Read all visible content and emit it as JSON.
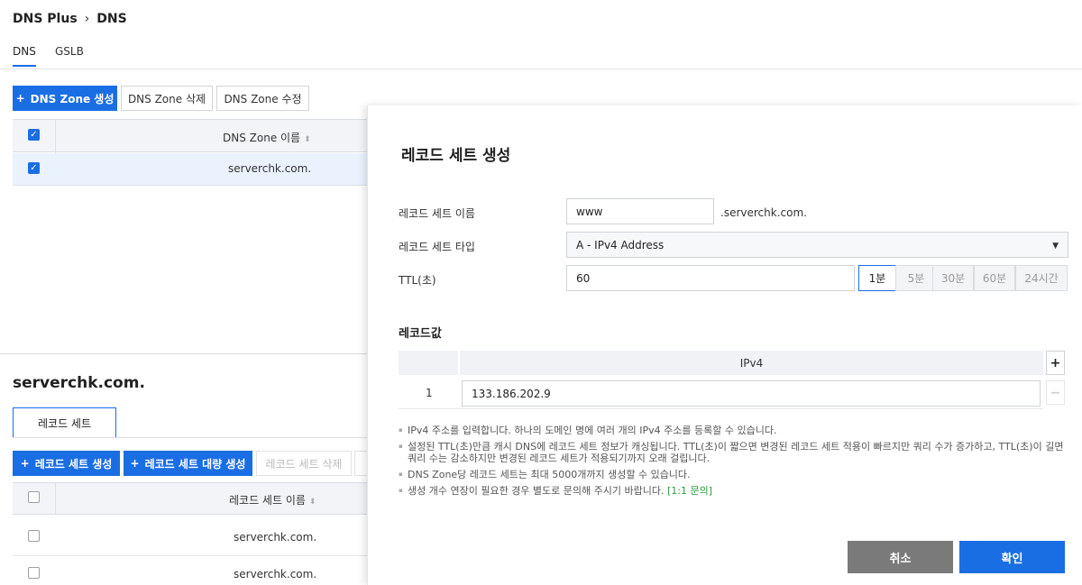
{
  "breadcrumb": {
    "root": "DNS Plus",
    "separator": "›",
    "current": "DNS"
  },
  "tabs": [
    {
      "label": "DNS",
      "active": true
    },
    {
      "label": "GSLB",
      "active": false
    }
  ],
  "zone_toolbar": {
    "create": "DNS Zone 생성",
    "delete": "DNS Zone 삭제",
    "edit": "DNS Zone 수정"
  },
  "zone_table": {
    "header": "DNS Zone 이름",
    "rows": [
      {
        "name": "serverchk.com.",
        "checked": true
      }
    ]
  },
  "zone_detail": {
    "title": "serverchk.com.",
    "subtab": "레코드 세트",
    "toolbar": {
      "create": "레코드 세트 생성",
      "bulk_create": "레코드 세트 대량 생성",
      "delete": "레코드 세트 삭제"
    },
    "table_header": "레코드 세트 이름",
    "rows": [
      {
        "name": "serverchk.com."
      },
      {
        "name": "serverchk.com."
      }
    ]
  },
  "panel": {
    "title": "레코드 세트 생성",
    "name_label": "레코드 세트 이름",
    "name_value": "www",
    "name_suffix": ".serverchk.com.",
    "type_label": "레코드 세트 타입",
    "type_value": "A - IPv4 Address",
    "ttl_label": "TTL(초)",
    "ttl_value": "60",
    "ttl_options": [
      {
        "label": "1분",
        "active": true
      },
      {
        "label": "5분",
        "active": false
      },
      {
        "label": "30분",
        "active": false
      },
      {
        "label": "60분",
        "active": false
      },
      {
        "label": "24시간",
        "active": false
      }
    ],
    "record_values_title": "레코드값",
    "record_values_header": "IPv4",
    "records": [
      {
        "index": "1",
        "value": "133.186.202.9"
      }
    ],
    "add_symbol": "+",
    "remove_symbol": "−",
    "notes": [
      "IPv4 주소를 입력합니다. 하나의 도메인 명에 여러 개의 IPv4 주소를 등록할 수 있습니다.",
      "설정된 TTL(초)만큼 캐시 DNS에 레코드 세트 정보가 캐싱됩니다. TTL(초)이 짧으면 변경된 레코드 세트 적용이 빠르지만 쿼리 수가 증가하고, TTL(초)이 길면 쿼리 수는 감소하지만 변경된 레코드 세트가 적용되기까지 오래 걸립니다.",
      "DNS Zone당 레코드 세트는 최대 5000개까지 생성할 수 있습니다."
    ],
    "last_note": "생성 개수 연장이 필요한 경우 별도로 문의해 주시기 바랍니다.",
    "last_note_link": "[1:1 문의]",
    "cancel": "취소",
    "confirm": "확인"
  },
  "colors": {
    "primary": "#1a6ee3",
    "cancel": "#7a7a7a",
    "link": "#2a9d3f"
  }
}
